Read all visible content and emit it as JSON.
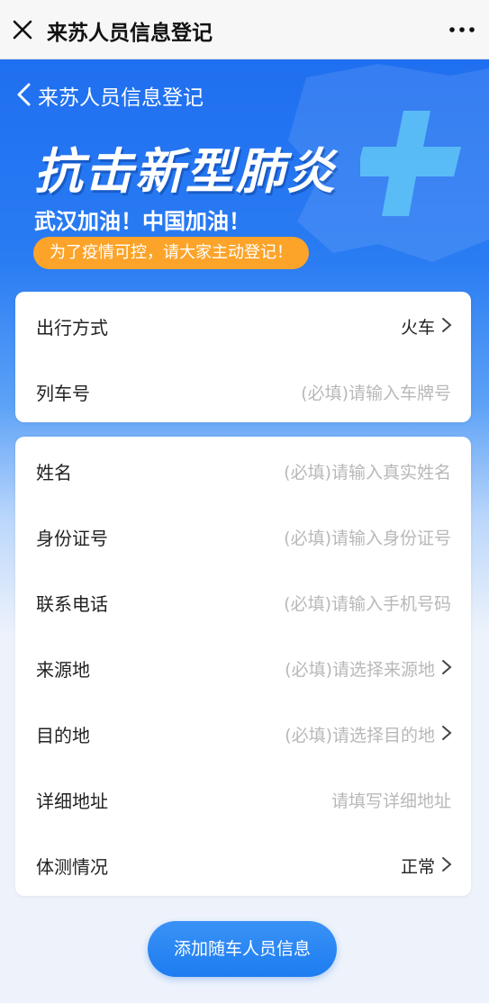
{
  "topbar": {
    "title": "来苏人员信息登记",
    "close_icon": "close-icon",
    "more_icon": "more-icon"
  },
  "hero": {
    "subtitle": "来苏人员信息登记",
    "slogan": "抗击新型肺炎",
    "cheer": "武汉加油！中国加油！",
    "notice": "为了疫情可控，请大家主动登记！"
  },
  "travel": {
    "rows": [
      {
        "label": "出行方式",
        "value": "火车",
        "placeholder": false,
        "arrow": true
      },
      {
        "label": "列车号",
        "value": "(必填)请输入车牌号",
        "placeholder": true,
        "arrow": false
      }
    ]
  },
  "person": {
    "rows": [
      {
        "label": "姓名",
        "value": "(必填)请输入真实姓名",
        "placeholder": true,
        "arrow": false
      },
      {
        "label": "身份证号",
        "value": "(必填)请输入身份证号",
        "placeholder": true,
        "arrow": false
      },
      {
        "label": "联系电话",
        "value": "(必填)请输入手机号码",
        "placeholder": true,
        "arrow": false
      },
      {
        "label": "来源地",
        "value": "(必填)请选择来源地",
        "placeholder": true,
        "arrow": true
      },
      {
        "label": "目的地",
        "value": "(必填)请选择目的地",
        "placeholder": true,
        "arrow": true
      },
      {
        "label": "详细地址",
        "value": "请填写详细地址",
        "placeholder": true,
        "arrow": false
      },
      {
        "label": "体测情况",
        "value": "正常",
        "placeholder": false,
        "arrow": true
      }
    ]
  },
  "add_button": {
    "label": "添加随车人员信息"
  },
  "colors": {
    "primary": "#1d7cf0",
    "accent": "#fca42a",
    "placeholder": "#b8b8b8"
  }
}
